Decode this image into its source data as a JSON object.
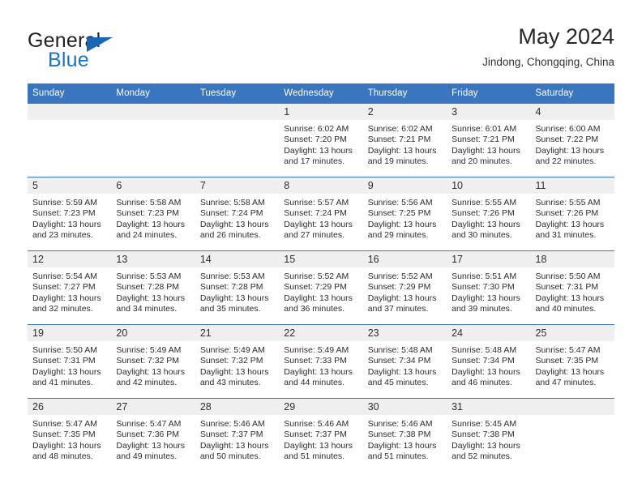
{
  "brand": {
    "name_part1": "General",
    "name_part2": "Blue",
    "triangle_icon": "triangle-icon",
    "colors": {
      "general_text": "#231f20",
      "blue_text": "#1575c8",
      "triangle": "#1668b5"
    }
  },
  "header": {
    "title": "May 2024",
    "subtitle": "Jindong, Chongqing, China"
  },
  "theme": {
    "header_blue": "#3a76bf",
    "row_divider_blue": "#3a76bf",
    "daynum_band": "#efefef",
    "cell_background": "#ffffff"
  },
  "weekday_headers": [
    "Sunday",
    "Monday",
    "Tuesday",
    "Wednesday",
    "Thursday",
    "Friday",
    "Saturday"
  ],
  "weeks": [
    [
      {
        "day": "",
        "sunrise": "",
        "sunset": "",
        "daylight_line1": "",
        "daylight_line2": ""
      },
      {
        "day": "",
        "sunrise": "",
        "sunset": "",
        "daylight_line1": "",
        "daylight_line2": ""
      },
      {
        "day": "",
        "sunrise": "",
        "sunset": "",
        "daylight_line1": "",
        "daylight_line2": ""
      },
      {
        "day": "1",
        "sunrise": "Sunrise: 6:02 AM",
        "sunset": "Sunset: 7:20 PM",
        "daylight_line1": "Daylight: 13 hours",
        "daylight_line2": "and 17 minutes."
      },
      {
        "day": "2",
        "sunrise": "Sunrise: 6:02 AM",
        "sunset": "Sunset: 7:21 PM",
        "daylight_line1": "Daylight: 13 hours",
        "daylight_line2": "and 19 minutes."
      },
      {
        "day": "3",
        "sunrise": "Sunrise: 6:01 AM",
        "sunset": "Sunset: 7:21 PM",
        "daylight_line1": "Daylight: 13 hours",
        "daylight_line2": "and 20 minutes."
      },
      {
        "day": "4",
        "sunrise": "Sunrise: 6:00 AM",
        "sunset": "Sunset: 7:22 PM",
        "daylight_line1": "Daylight: 13 hours",
        "daylight_line2": "and 22 minutes."
      }
    ],
    [
      {
        "day": "5",
        "sunrise": "Sunrise: 5:59 AM",
        "sunset": "Sunset: 7:23 PM",
        "daylight_line1": "Daylight: 13 hours",
        "daylight_line2": "and 23 minutes."
      },
      {
        "day": "6",
        "sunrise": "Sunrise: 5:58 AM",
        "sunset": "Sunset: 7:23 PM",
        "daylight_line1": "Daylight: 13 hours",
        "daylight_line2": "and 24 minutes."
      },
      {
        "day": "7",
        "sunrise": "Sunrise: 5:58 AM",
        "sunset": "Sunset: 7:24 PM",
        "daylight_line1": "Daylight: 13 hours",
        "daylight_line2": "and 26 minutes."
      },
      {
        "day": "8",
        "sunrise": "Sunrise: 5:57 AM",
        "sunset": "Sunset: 7:24 PM",
        "daylight_line1": "Daylight: 13 hours",
        "daylight_line2": "and 27 minutes."
      },
      {
        "day": "9",
        "sunrise": "Sunrise: 5:56 AM",
        "sunset": "Sunset: 7:25 PM",
        "daylight_line1": "Daylight: 13 hours",
        "daylight_line2": "and 29 minutes."
      },
      {
        "day": "10",
        "sunrise": "Sunrise: 5:55 AM",
        "sunset": "Sunset: 7:26 PM",
        "daylight_line1": "Daylight: 13 hours",
        "daylight_line2": "and 30 minutes."
      },
      {
        "day": "11",
        "sunrise": "Sunrise: 5:55 AM",
        "sunset": "Sunset: 7:26 PM",
        "daylight_line1": "Daylight: 13 hours",
        "daylight_line2": "and 31 minutes."
      }
    ],
    [
      {
        "day": "12",
        "sunrise": "Sunrise: 5:54 AM",
        "sunset": "Sunset: 7:27 PM",
        "daylight_line1": "Daylight: 13 hours",
        "daylight_line2": "and 32 minutes."
      },
      {
        "day": "13",
        "sunrise": "Sunrise: 5:53 AM",
        "sunset": "Sunset: 7:28 PM",
        "daylight_line1": "Daylight: 13 hours",
        "daylight_line2": "and 34 minutes."
      },
      {
        "day": "14",
        "sunrise": "Sunrise: 5:53 AM",
        "sunset": "Sunset: 7:28 PM",
        "daylight_line1": "Daylight: 13 hours",
        "daylight_line2": "and 35 minutes."
      },
      {
        "day": "15",
        "sunrise": "Sunrise: 5:52 AM",
        "sunset": "Sunset: 7:29 PM",
        "daylight_line1": "Daylight: 13 hours",
        "daylight_line2": "and 36 minutes."
      },
      {
        "day": "16",
        "sunrise": "Sunrise: 5:52 AM",
        "sunset": "Sunset: 7:29 PM",
        "daylight_line1": "Daylight: 13 hours",
        "daylight_line2": "and 37 minutes."
      },
      {
        "day": "17",
        "sunrise": "Sunrise: 5:51 AM",
        "sunset": "Sunset: 7:30 PM",
        "daylight_line1": "Daylight: 13 hours",
        "daylight_line2": "and 39 minutes."
      },
      {
        "day": "18",
        "sunrise": "Sunrise: 5:50 AM",
        "sunset": "Sunset: 7:31 PM",
        "daylight_line1": "Daylight: 13 hours",
        "daylight_line2": "and 40 minutes."
      }
    ],
    [
      {
        "day": "19",
        "sunrise": "Sunrise: 5:50 AM",
        "sunset": "Sunset: 7:31 PM",
        "daylight_line1": "Daylight: 13 hours",
        "daylight_line2": "and 41 minutes."
      },
      {
        "day": "20",
        "sunrise": "Sunrise: 5:49 AM",
        "sunset": "Sunset: 7:32 PM",
        "daylight_line1": "Daylight: 13 hours",
        "daylight_line2": "and 42 minutes."
      },
      {
        "day": "21",
        "sunrise": "Sunrise: 5:49 AM",
        "sunset": "Sunset: 7:32 PM",
        "daylight_line1": "Daylight: 13 hours",
        "daylight_line2": "and 43 minutes."
      },
      {
        "day": "22",
        "sunrise": "Sunrise: 5:49 AM",
        "sunset": "Sunset: 7:33 PM",
        "daylight_line1": "Daylight: 13 hours",
        "daylight_line2": "and 44 minutes."
      },
      {
        "day": "23",
        "sunrise": "Sunrise: 5:48 AM",
        "sunset": "Sunset: 7:34 PM",
        "daylight_line1": "Daylight: 13 hours",
        "daylight_line2": "and 45 minutes."
      },
      {
        "day": "24",
        "sunrise": "Sunrise: 5:48 AM",
        "sunset": "Sunset: 7:34 PM",
        "daylight_line1": "Daylight: 13 hours",
        "daylight_line2": "and 46 minutes."
      },
      {
        "day": "25",
        "sunrise": "Sunrise: 5:47 AM",
        "sunset": "Sunset: 7:35 PM",
        "daylight_line1": "Daylight: 13 hours",
        "daylight_line2": "and 47 minutes."
      }
    ],
    [
      {
        "day": "26",
        "sunrise": "Sunrise: 5:47 AM",
        "sunset": "Sunset: 7:35 PM",
        "daylight_line1": "Daylight: 13 hours",
        "daylight_line2": "and 48 minutes."
      },
      {
        "day": "27",
        "sunrise": "Sunrise: 5:47 AM",
        "sunset": "Sunset: 7:36 PM",
        "daylight_line1": "Daylight: 13 hours",
        "daylight_line2": "and 49 minutes."
      },
      {
        "day": "28",
        "sunrise": "Sunrise: 5:46 AM",
        "sunset": "Sunset: 7:37 PM",
        "daylight_line1": "Daylight: 13 hours",
        "daylight_line2": "and 50 minutes."
      },
      {
        "day": "29",
        "sunrise": "Sunrise: 5:46 AM",
        "sunset": "Sunset: 7:37 PM",
        "daylight_line1": "Daylight: 13 hours",
        "daylight_line2": "and 51 minutes."
      },
      {
        "day": "30",
        "sunrise": "Sunrise: 5:46 AM",
        "sunset": "Sunset: 7:38 PM",
        "daylight_line1": "Daylight: 13 hours",
        "daylight_line2": "and 51 minutes."
      },
      {
        "day": "31",
        "sunrise": "Sunrise: 5:45 AM",
        "sunset": "Sunset: 7:38 PM",
        "daylight_line1": "Daylight: 13 hours",
        "daylight_line2": "and 52 minutes."
      },
      {
        "day": "",
        "sunrise": "",
        "sunset": "",
        "daylight_line1": "",
        "daylight_line2": ""
      }
    ]
  ]
}
